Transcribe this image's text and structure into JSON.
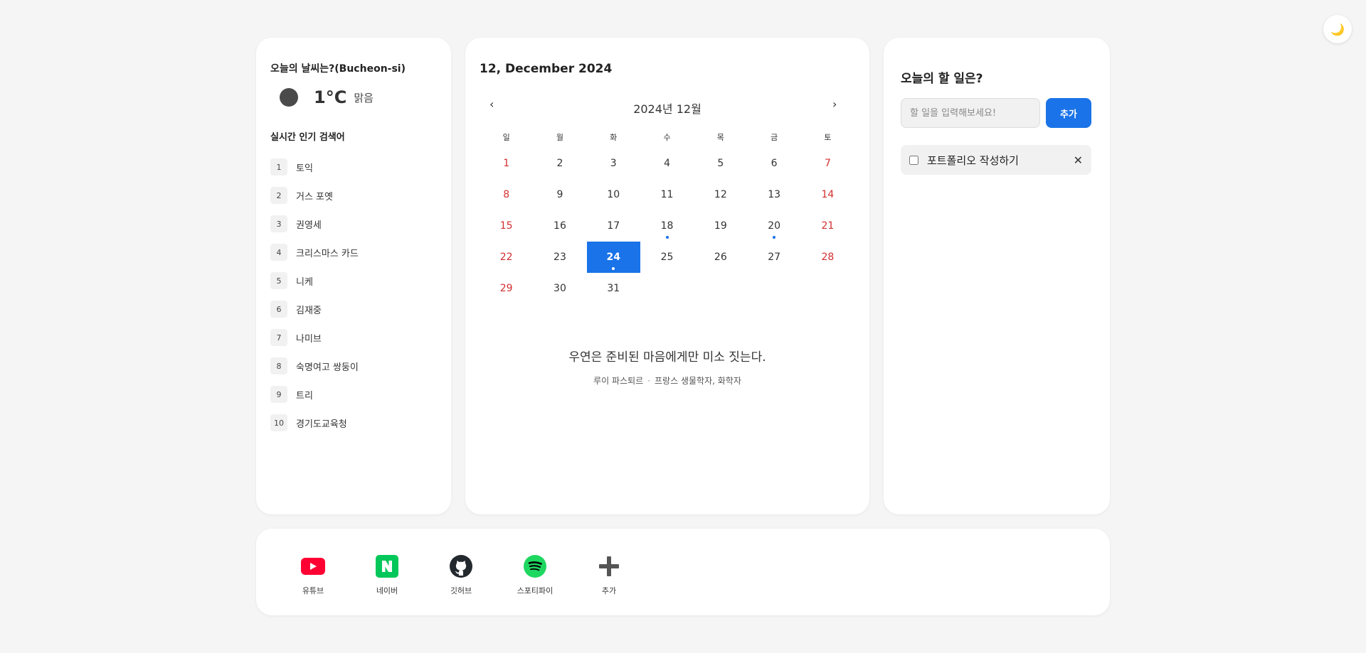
{
  "theme_toggle": {
    "icon": "moon-icon",
    "glyph": "🌙"
  },
  "weather": {
    "title": "오늘의 날씨는?(Bucheon-si)",
    "temperature": "1°C",
    "condition": "맑음"
  },
  "trending": {
    "title": "실시간 인기 검색어",
    "items": [
      {
        "rank": "1",
        "term": "토익"
      },
      {
        "rank": "2",
        "term": "거스 포옛"
      },
      {
        "rank": "3",
        "term": "권영세"
      },
      {
        "rank": "4",
        "term": "크리스마스 카드"
      },
      {
        "rank": "5",
        "term": "니케"
      },
      {
        "rank": "6",
        "term": "김재중"
      },
      {
        "rank": "7",
        "term": "나미브"
      },
      {
        "rank": "8",
        "term": "숙명여고 쌍둥이"
      },
      {
        "rank": "9",
        "term": "트리"
      },
      {
        "rank": "10",
        "term": "경기도교육청"
      }
    ]
  },
  "calendar": {
    "date_heading": "12, December 2024",
    "month_label": "2024년 12월",
    "prev": "‹",
    "next": "›",
    "weekdays": [
      "일",
      "월",
      "화",
      "수",
      "목",
      "금",
      "토"
    ],
    "leading_blanks": 0,
    "days": [
      "1",
      "2",
      "3",
      "4",
      "5",
      "6",
      "7",
      "8",
      "9",
      "10",
      "11",
      "12",
      "13",
      "14",
      "15",
      "16",
      "17",
      "18",
      "19",
      "20",
      "21",
      "22",
      "23",
      "24",
      "25",
      "26",
      "27",
      "28",
      "29",
      "30",
      "31"
    ],
    "selected_day": "24",
    "event_days": [
      "18",
      "20",
      "24"
    ],
    "weekend_color": "#d32f2f",
    "accent": "#1a73e8"
  },
  "quote": {
    "text": "우연은 준비된 마음에게만 미소 짓는다.",
    "author": "루이 파스퇴르",
    "separator": "·",
    "role": "프랑스 생물학자, 화학자"
  },
  "todo": {
    "title": "오늘의 할 일은?",
    "input_placeholder": "할 일을 입력해보세요!",
    "input_value": "",
    "add_label": "추가",
    "items": [
      {
        "text": "포트폴리오 작성하기",
        "done": false,
        "delete_glyph": "✕"
      }
    ]
  },
  "shortcuts": [
    {
      "label": "유튜브",
      "icon": "youtube-icon",
      "color": "#ff0033"
    },
    {
      "label": "네이버",
      "icon": "naver-icon",
      "color": "#03c75a"
    },
    {
      "label": "깃허브",
      "icon": "github-icon",
      "color": "#24292e"
    },
    {
      "label": "스포티파이",
      "icon": "spotify-icon",
      "color": "#1ed760"
    },
    {
      "label": "추가",
      "icon": "plus-icon",
      "color": "#555555"
    }
  ]
}
